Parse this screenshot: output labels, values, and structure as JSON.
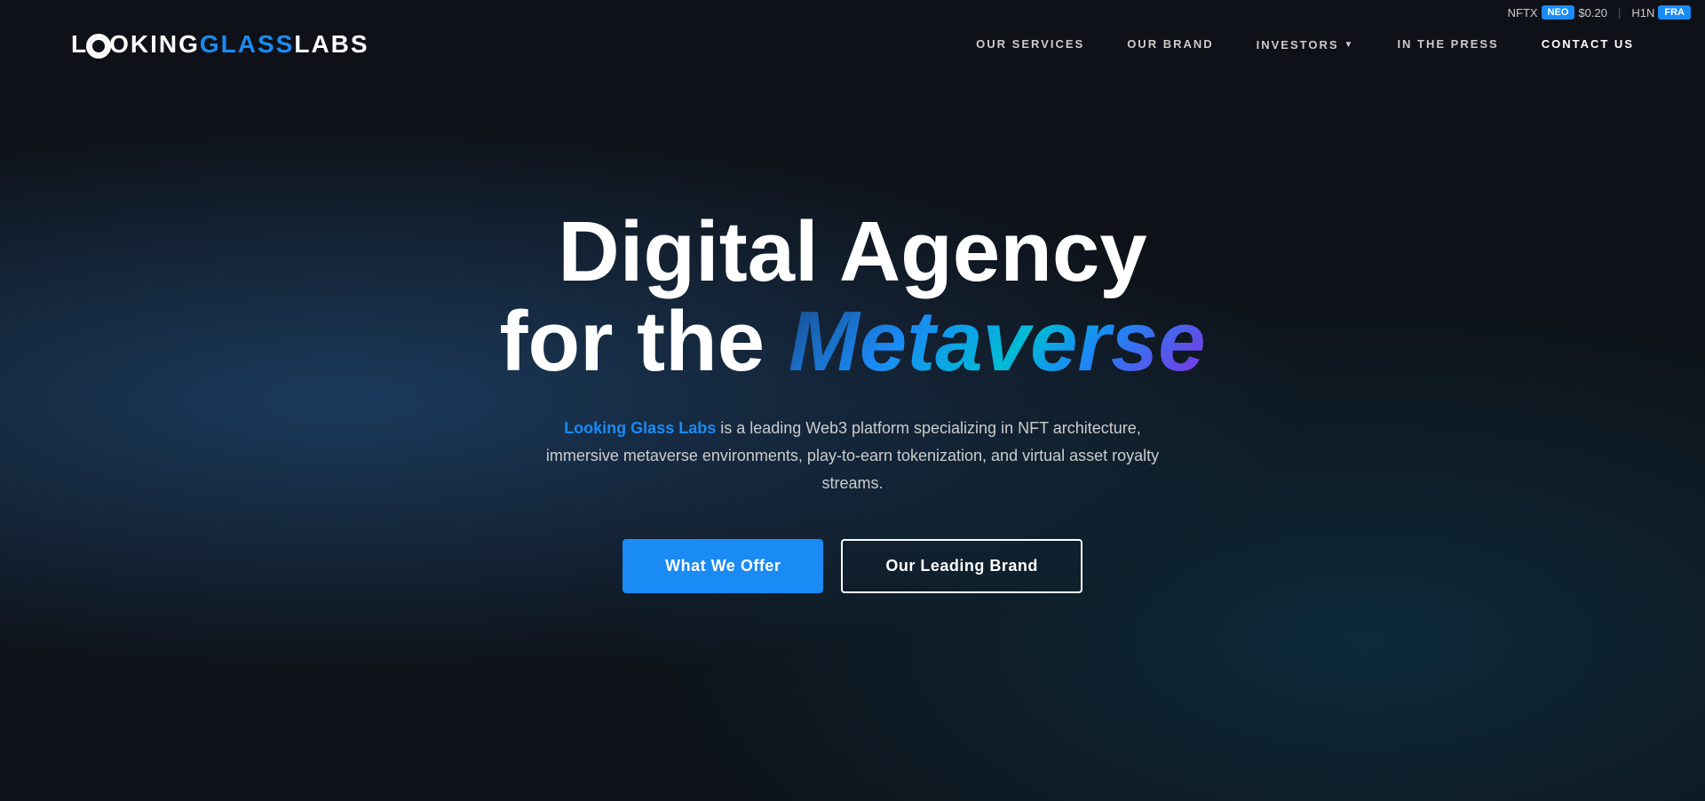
{
  "ticker": {
    "nftx_label": "NFTX",
    "neo_badge": "NEO",
    "price": "$0.20",
    "h1n_label": "H1N",
    "fra_badge": "FRA"
  },
  "nav": {
    "logo": {
      "part1": "L",
      "part2": "OKING",
      "part3": "GLASS",
      "part4": "LABS"
    },
    "links": [
      {
        "label": "OUR SERVICES",
        "id": "our-services"
      },
      {
        "label": "OUR BRAND",
        "id": "our-brand"
      },
      {
        "label": "INVESTORS",
        "id": "investors"
      },
      {
        "label": "IN THE PRESS",
        "id": "in-the-press"
      },
      {
        "label": "CONTACT US",
        "id": "contact-us"
      }
    ]
  },
  "hero": {
    "title_line1": "Digital Agency",
    "title_line2_prefix": "for the ",
    "title_line2_highlight": "Metaverse",
    "description_brand": "Looking Glass Labs",
    "description_rest": " is a leading Web3 platform specializing in NFT architecture, immersive metaverse environments, play-to-earn tokenization, and virtual asset royalty streams.",
    "btn_primary": "What We Offer",
    "btn_secondary": "Our Leading Brand"
  }
}
